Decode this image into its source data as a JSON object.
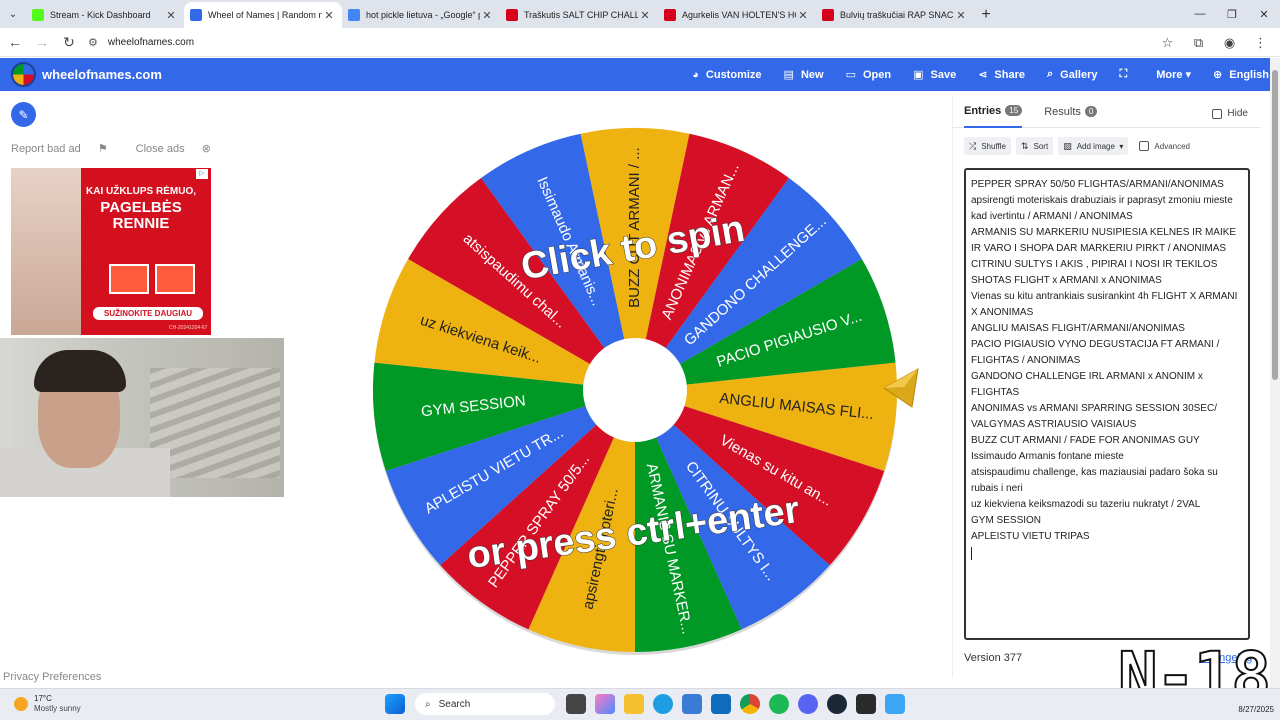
{
  "browser": {
    "tabs": [
      {
        "title": "Stream - Kick Dashboard",
        "color": "#53fc18",
        "active": false
      },
      {
        "title": "Wheel of Names | Random nam",
        "color": "#3369e8",
        "active": true
      },
      {
        "title": "hot pickle lietuva - „Google“ pa",
        "color": "#4285f4",
        "active": false
      },
      {
        "title": "Traškutis SALT CHIP CHALLENG",
        "color": "#d6001c",
        "active": false
      },
      {
        "title": "Agurkelis VAN HOLTEN'S HOT P",
        "color": "#d6001c",
        "active": false
      },
      {
        "title": "Bulvių traškučiai RAP SNACKS L",
        "color": "#d6001c",
        "active": false
      }
    ],
    "url": "wheelofnames.com"
  },
  "site": {
    "name": "wheelofnames.com",
    "menu": [
      {
        "icon": "palette-icon",
        "glyph": "◕",
        "label": "Customize"
      },
      {
        "icon": "file-icon",
        "glyph": "▤",
        "label": "New"
      },
      {
        "icon": "folder-icon",
        "glyph": "▭",
        "label": "Open"
      },
      {
        "icon": "save-icon",
        "glyph": "▣",
        "label": "Save"
      },
      {
        "icon": "share-icon",
        "glyph": "⋖",
        "label": "Share"
      },
      {
        "icon": "search-icon",
        "glyph": "⌕",
        "label": "Gallery"
      },
      {
        "icon": "fullscreen-icon",
        "glyph": "⛶",
        "label": ""
      },
      {
        "icon": "chevron-down-icon",
        "glyph": "",
        "label": "More ▾"
      },
      {
        "icon": "globe-icon",
        "glyph": "⊕",
        "label": "English"
      }
    ]
  },
  "left": {
    "report_ad": "Report bad ad",
    "close_ads": "Close ads",
    "ad": {
      "line1": "KAI UŽKLUPS RĖMUO,",
      "line2": "PAGELBĖS RENNIE",
      "cta": "SUŽINOKITE DAUGIAU",
      "code": "CH-20241204-67"
    },
    "privacy": "Privacy Preferences"
  },
  "wheel": {
    "click_text": "Click to spin",
    "press_text": "or press ctrl+enter",
    "colors": [
      "#eeb211",
      "#d50f25",
      "#3369e8",
      "#009925"
    ],
    "segments": [
      "BUZZ CUT ARMANI / ...",
      "ANONIMAS vs ARMAN...",
      "GANDONO CHALLENGE...",
      "PACIO PIGIAUSIO V...",
      "ANGLIU MAISAS FLI...",
      "Vienas su kitu an...",
      "CITRINU SULTYS I...",
      "ARMANIS SU MARKER...",
      "apsirengti moteri...",
      "PEPPER SPRAY 50/5...",
      "APLEISTU VIETU TR...",
      "GYM SESSION",
      "uz kiekviena keik...",
      "atsispaudimu chal...",
      "Issimaudo Armanis..."
    ]
  },
  "panel": {
    "tab_entries": "Entries",
    "entries_count": "15",
    "tab_results": "Results",
    "results_count": "0",
    "hide": "Hide",
    "shuffle": "Shuffle",
    "sort": "Sort",
    "add_image": "Add image",
    "advanced": "Advanced",
    "entries": [
      "PEPPER SPRAY 50/50 FLIGHTAS/ARMANI/ANONIMAS",
      "apsirengti moteriskais drabuziais ir paprasyt zmoniu mieste kad ivertintu / ARMANI / ANONIMAS",
      "ARMANIS SU MARKERIU NUSIPIESIA KELNES IR MAIKE IR VARO I SHOPA DAR MARKERIU PIRKT / ANONIMAS",
      "CITRINU SULTYS I AKIS , PIPIRAI I NOSI IR TEKILOS SHOTAS FLIGHT x ARMANI x ANONIMAS",
      "Vienas su kitu antrankiais susirankint 4h FLIGHT X ARMANI X ANONIMAS",
      "ANGLIU MAISAS FLIGHT/ARMANI/ANONIMAS",
      "PACIO PIGIAUSIO VYNO DEGUSTACIJA FT ARMANI / FLIGHTAS / ANONIMAS",
      "GANDONO CHALLENGE IRL ARMANI x ANONIM x FLIGHTAS",
      "ANONIMAS vs ARMANI SPARRING SESSION 30SEC/ VALGYMAS ASTRIAUSIO VAISIAUS",
      "BUZZ CUT ARMANI / FADE FOR ANONIMAS GUY",
      "Issimaudo Armanis fontane mieste",
      "atsispaudimu challenge, kas maziausiai padaro šoka su rubais i neri",
      "uz kiekviena keiksmazodi su tazeriu nukratyt / 2VAL",
      "GYM SESSION",
      "APLEISTU VIETU TRIPAS"
    ],
    "version": "Version 377",
    "changelog": "Changelog"
  },
  "watermark": "N-18",
  "taskbar": {
    "temp": "17°C",
    "condition": "Mostly sunny",
    "search": "Search",
    "date": "8/27/2025"
  }
}
